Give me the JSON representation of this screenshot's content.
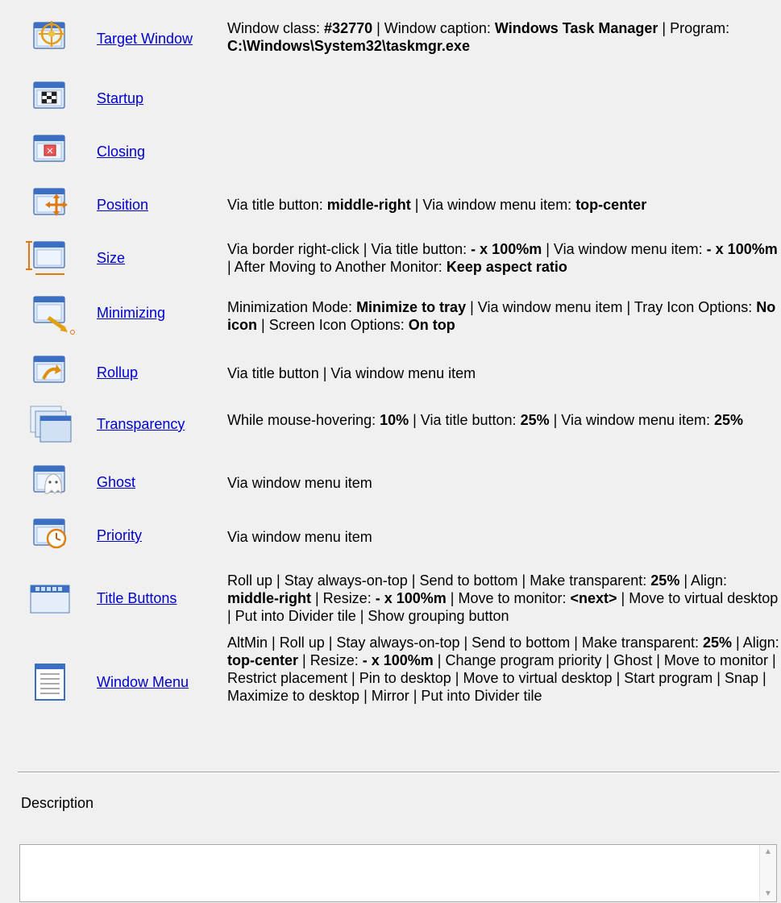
{
  "rows": [
    {
      "icon": "target-window-icon",
      "label": "Target Window",
      "desc": [
        [
          "Window class: ",
          0
        ],
        [
          "#32770",
          1
        ],
        [
          " | Window caption: ",
          0
        ],
        [
          "Windows Task Manager",
          1
        ],
        [
          " | Program: ",
          0
        ],
        [
          "C:\\Windows\\System32\\taskmgr.exe",
          1
        ]
      ]
    },
    {
      "icon": "startup-icon",
      "label": "Startup",
      "desc": []
    },
    {
      "icon": "closing-icon",
      "label": "Closing",
      "desc": []
    },
    {
      "icon": "position-icon",
      "label": "Position",
      "desc": [
        [
          "Via title button: ",
          0
        ],
        [
          "middle-right",
          1
        ],
        [
          " | Via window menu item: ",
          0
        ],
        [
          "top-center",
          1
        ]
      ]
    },
    {
      "icon": "size-icon",
      "label": "Size",
      "desc": [
        [
          "Via border right-click | Via title button: ",
          0
        ],
        [
          "- x 100%m",
          1
        ],
        [
          " | Via window menu item: ",
          0
        ],
        [
          "- x 100%m",
          1
        ],
        [
          " | After Moving to Another Monitor: ",
          0
        ],
        [
          "Keep aspect ratio",
          1
        ]
      ]
    },
    {
      "icon": "minimizing-icon",
      "label": "Minimizing",
      "desc": [
        [
          "Minimization Mode: ",
          0
        ],
        [
          "Minimize to tray",
          1
        ],
        [
          " | Via window menu item | Tray Icon Options: ",
          0
        ],
        [
          "No icon",
          1
        ],
        [
          " | Screen Icon Options: ",
          0
        ],
        [
          "On top",
          1
        ]
      ]
    },
    {
      "icon": "rollup-icon",
      "label": "Rollup",
      "desc": [
        [
          "Via title button | Via window menu item",
          0
        ]
      ]
    },
    {
      "icon": "transparency-icon",
      "label": "Transparency",
      "desc": [
        [
          "While mouse-hovering: ",
          0
        ],
        [
          "10%",
          1
        ],
        [
          " | Via title button: ",
          0
        ],
        [
          "25%",
          1
        ],
        [
          " | Via window menu item: ",
          0
        ],
        [
          "25%",
          1
        ]
      ]
    },
    {
      "icon": "ghost-icon",
      "label": "Ghost",
      "desc": [
        [
          "Via window menu item",
          0
        ]
      ]
    },
    {
      "icon": "priority-icon",
      "label": "Priority",
      "desc": [
        [
          "Via window menu item",
          0
        ]
      ]
    },
    {
      "icon": "title-buttons-icon",
      "label": "Title Buttons",
      "desc": [
        [
          "Roll up | Stay always-on-top | Send to bottom | Make transparent: ",
          0
        ],
        [
          "25%",
          1
        ],
        [
          " | Align: ",
          0
        ],
        [
          "middle-right",
          1
        ],
        [
          " | Resize: ",
          0
        ],
        [
          "- x 100%m",
          1
        ],
        [
          " | Move to monitor: ",
          0
        ],
        [
          "<next>",
          1
        ],
        [
          " | Move to virtual desktop | Put into Divider tile | Show grouping button",
          0
        ]
      ]
    },
    {
      "icon": "window-menu-icon",
      "label": "Window Menu",
      "desc": [
        [
          "AltMin | Roll up | Stay always-on-top | Send to bottom | Make transparent: ",
          0
        ],
        [
          "25%",
          1
        ],
        [
          " | Align: ",
          0
        ],
        [
          "top-center",
          1
        ],
        [
          " | Resize: ",
          0
        ],
        [
          "- x 100%m",
          1
        ],
        [
          " | Change program priority | Ghost | Move to monitor | Restrict placement | Pin to desktop | Move to virtual desktop | Start program | Snap | Maximize to desktop | Mirror | Put into Divider tile",
          0
        ]
      ]
    }
  ],
  "description_label": "Description",
  "description_value": ""
}
